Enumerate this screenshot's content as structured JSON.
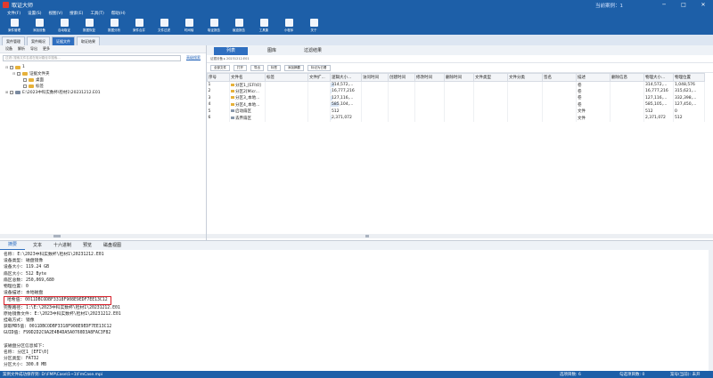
{
  "titlebar": {
    "title": "取证大师",
    "case_label": "当前案例：1"
  },
  "menu": [
    "文件(F)",
    "设置(S)",
    "视图(V)",
    "搜索(E)",
    "工具(T)",
    "帮助(H)"
  ],
  "toolbar": [
    "案件管理",
    "添加设备",
    "自动取证",
    "数据恢复",
    "数据分析",
    "案件合并",
    "文件过滤",
    "时间轴",
    "取证报告",
    "痕迹报告",
    "工具集",
    "小程序",
    "关于"
  ],
  "doc_tabs": [
    "案件管理",
    "案件概况",
    "证据文件",
    "取证结果"
  ],
  "left": {
    "tools": [
      "设备",
      "解析",
      "导出",
      "更多"
    ],
    "search_placeholder": "过滤/ 搜索文件名或在相对路径中搜索...",
    "advanced": "高级搜索",
    "tree": [
      "1",
      "证据文件夹",
      "桌面",
      "标签",
      "E:\\2023中科实数杯\\检材1\\20231212.E01"
    ]
  },
  "right": {
    "tabs": [
      "列表",
      "图库",
      "过滤结果"
    ],
    "breadcrumb": "证据设备 ▸ 20231212.E01",
    "tools": [
      "全部文件",
      "打开",
      "导出",
      "标签",
      "添加摘要",
      "标记为已看"
    ],
    "headers": [
      "序号",
      "文件名",
      "标签",
      "文件扩...",
      "逻辑大小...",
      "访问时间",
      "创建时间",
      "修改时间",
      "删除时间",
      "文件类型",
      "文件分类",
      "签名",
      "描述",
      "删除信息",
      "物理大小...",
      "物理位置"
    ],
    "rows": [
      {
        "n": "1",
        "name": "分区1_[EFI\\0]",
        "logical": "314,572,...",
        "bar": 0.13,
        "desc": "卷",
        "physical": "314,572,...",
        "pos": "1,048,576"
      },
      {
        "n": "2",
        "name": "分区2[Micr...",
        "logical": "16,777,216",
        "bar": 0.01,
        "desc": "卷",
        "physical": "16,777,216",
        "pos": "315,621,..."
      },
      {
        "n": "3",
        "name": "分区3_本地...",
        "logical": "127,116,...",
        "bar": 0.05,
        "desc": "卷",
        "physical": "127,116,...",
        "pos": "332,398,..."
      },
      {
        "n": "4",
        "name": "分区4_本地...",
        "logical": "585,104,...",
        "bar": 0.25,
        "desc": "卷",
        "physical": "585,105,...",
        "pos": "127,450,..."
      },
      {
        "n": "5",
        "name": "启动扇区",
        "logical": "512",
        "bar": 0.0,
        "desc": "文件",
        "physical": "512",
        "pos": "0"
      },
      {
        "n": "6",
        "name": "丢弃扇区",
        "logical": "2,371,072",
        "bar": 0.01,
        "desc": "文件",
        "physical": "2,371,072",
        "pos": "512"
      }
    ]
  },
  "bottom": {
    "tabs": [
      "摘要",
      "文本",
      "十六进制",
      "预览",
      "磁盘视图"
    ],
    "lines": [
      "名称: E:\\2023中科实数杯\\检材1\\20231212.E01",
      "设备类型: 磁盘镜像",
      "设备大小: 119.24 GB",
      "扇区大小: 512 Byte",
      "扇区总数: 250,069,680",
      "物理位置: 0",
      "设备描述: 本地磁盘",
      "哈希值: 0011DBCODBF3318F908E9EDF7EE13C12",
      "完整路径: 1:\\E:\\2023中科实数杯\\检材1\\20231212.E01",
      "原始镜像文件: E:\\2023中科实数杯\\检材1\\20231212.E01",
      "挂载方式: 镜像",
      "获取MD5值: 0011DBCODBF3318F908E9EDF7EE13C12",
      "GUID值: F99D2D2C9A2E4B4DA5A0760D3A8FAC3F82",
      "",
      "该磁盘分区信息如下:",
      "名称: 分区1_[EFI\\0]",
      "分区类型: FAT32",
      "分区大小: 300.0 MB"
    ]
  },
  "status": {
    "left": "案例文件成功保存到: D:\\FMP\\Case\\1~1\\FmCase.mpi",
    "selected": "选项目数: 6",
    "checked": "勾选项目数: 0",
    "current": "案号(当前): 未开"
  }
}
